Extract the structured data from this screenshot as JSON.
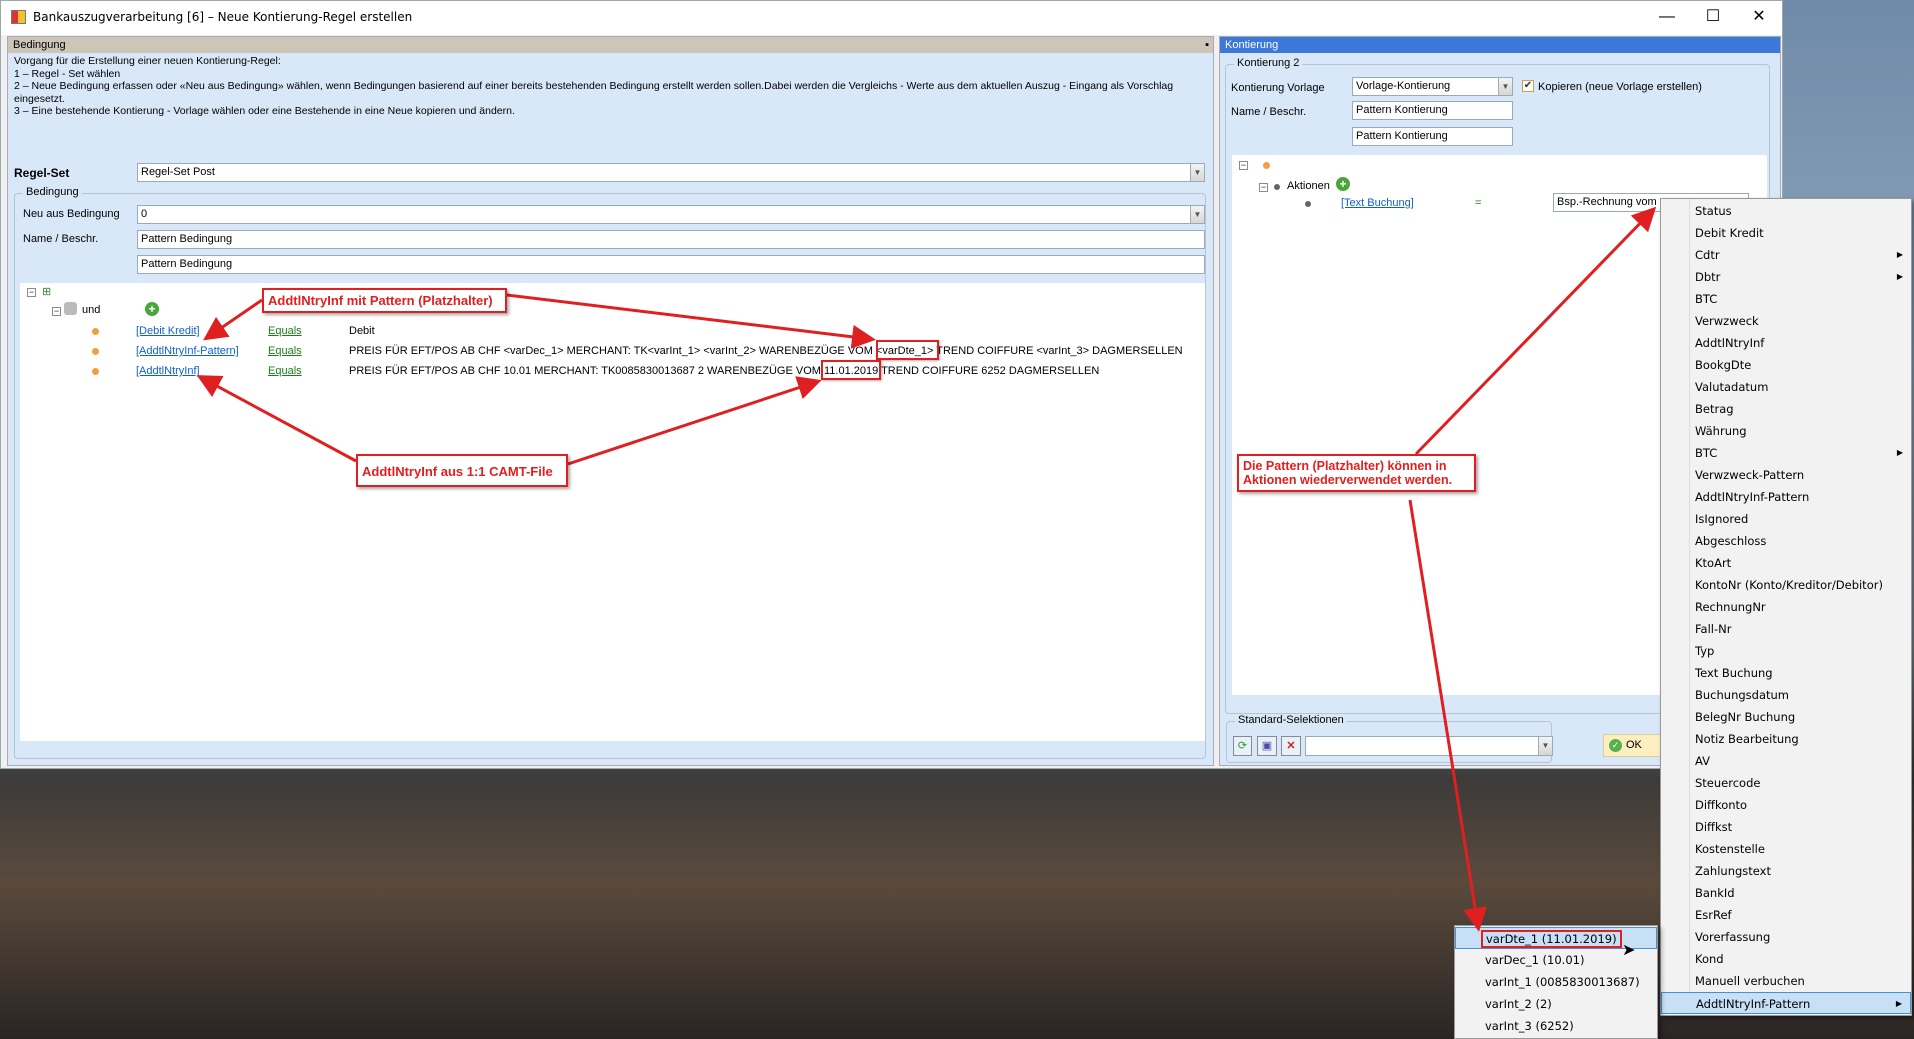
{
  "window": {
    "title": "Bankauszugverarbeitung [6] – Neue Kontierung-Regel erstellen",
    "minimize": "—",
    "maximize": "☐",
    "close": "✕"
  },
  "left": {
    "header": "Bedingung",
    "pin": "📌",
    "instructions": [
      "Vorgang für die Erstellung einer neuen Kontierung-Regel:",
      "1 – Regel - Set wählen",
      "2 – Neue Bedingung erfassen oder «Neu aus Bedingung» wählen, wenn Bedingungen basierend auf einer bereits bestehenden Bedingung erstellt werden sollen.Dabei werden die Vergleichs - Werte aus dem aktuellen Auszug - Eingang als Vorschlag eingesetzt.",
      "3 – Eine bestehende Kontierung - Vorlage wählen oder eine Bestehende in eine Neue kopieren und ändern."
    ],
    "regelset_label": "Regel-Set",
    "regelset_value": "Regel-Set Post",
    "group_title": "Bedingung",
    "neu_label": "Neu aus Bedingung",
    "neu_value": "0",
    "name_label": "Name / Beschr.",
    "name_value": "Pattern Bedingung",
    "desc_value": "Pattern Bedingung",
    "tree": {
      "op": "und",
      "rows": [
        {
          "field": "[Debit Kredit]",
          "cmp": "Equals",
          "value": "Debit"
        },
        {
          "field": "[AddtlNtryInf-Pattern]",
          "cmp": "Equals",
          "value": "PREIS FÜR EFT/POS AB CHF <varDec_1> MERCHANT: TK<varInt_1> <varInt_2> WARENBEZÜGE VOM <varDte_1> TREND COIFFURE <varInt_3> DAGMERSELLEN"
        },
        {
          "field": "[AddtlNtryInf]",
          "cmp": "Equals",
          "value": "PREIS FÜR EFT/POS AB CHF 10.01 MERCHANT: TK0085830013687 2 WARENBEZÜGE VOM 11.01.2019 TREND COIFFURE 6252 DAGMERSELLEN"
        }
      ]
    }
  },
  "right": {
    "header": "Kontierung",
    "group_title": "Kontierung 2",
    "vorlage_label": "Kontierung Vorlage",
    "vorlage_value": "Vorlage-Kontierung",
    "copy_label": "Kopieren (neue Vorlage erstellen)",
    "copy_checked": true,
    "name_label": "Name / Beschr.",
    "name_value": "Pattern Kontierung",
    "desc_value": "Pattern Kontierung",
    "tree": {
      "actions_label": "Aktionen",
      "action_field": "[Text Buchung]",
      "action_op": "=",
      "action_value": "Bsp.-Rechnung vom"
    },
    "std_title": "Standard-Selektionen",
    "std_value": "",
    "ok_label": "OK"
  },
  "annotations": {
    "a1": "AddtlNtryInf mit Pattern (Platzhalter)",
    "a2": "AddtlNtryInf aus 1:1 CAMT-File",
    "a3": "Die Pattern (Platzhalter) können in Aktionen wiederverwendet werden.",
    "color": "#e02020"
  },
  "context_menu": {
    "items": [
      {
        "label": "Status"
      },
      {
        "label": "Debit Kredit"
      },
      {
        "label": "Cdtr",
        "sub": true
      },
      {
        "label": "Dbtr",
        "sub": true
      },
      {
        "label": "BTC"
      },
      {
        "label": "Verwzweck"
      },
      {
        "label": "AddtlNtryInf"
      },
      {
        "label": "BookgDte"
      },
      {
        "label": "Valutadatum"
      },
      {
        "label": "Betrag"
      },
      {
        "label": "Währung"
      },
      {
        "label": "BTC",
        "sub": true
      },
      {
        "label": "Verwzweck-Pattern"
      },
      {
        "label": "AddtlNtryInf-Pattern"
      },
      {
        "label": "IsIgnored"
      },
      {
        "label": "Abgeschloss"
      },
      {
        "label": "KtoArt"
      },
      {
        "label": "KontoNr (Konto/Kreditor/Debitor)"
      },
      {
        "label": "RechnungNr"
      },
      {
        "label": "Fall-Nr"
      },
      {
        "label": "Typ"
      },
      {
        "label": "Text Buchung"
      },
      {
        "label": "Buchungsdatum"
      },
      {
        "label": "BelegNr Buchung"
      },
      {
        "label": "Notiz Bearbeitung"
      },
      {
        "label": "AV"
      },
      {
        "label": "Steuercode"
      },
      {
        "label": "Diffkonto"
      },
      {
        "label": "Diffkst"
      },
      {
        "label": "Kostenstelle"
      },
      {
        "label": "Zahlungstext"
      },
      {
        "label": "BankId"
      },
      {
        "label": "EsrRef"
      },
      {
        "label": "Vorerfassung"
      },
      {
        "label": "Kond"
      },
      {
        "label": "Manuell verbuchen"
      },
      {
        "label": "AddtlNtryInf-Pattern",
        "sub": true,
        "selected": true
      }
    ]
  },
  "submenu": {
    "items": [
      {
        "label": "varDte_1 (11.01.2019)",
        "selected": true
      },
      {
        "label": "varDec_1 (10.01)"
      },
      {
        "label": "varInt_1 (0085830013687)"
      },
      {
        "label": "varInt_2 (2)"
      },
      {
        "label": "varInt_3 (6252)"
      }
    ]
  }
}
